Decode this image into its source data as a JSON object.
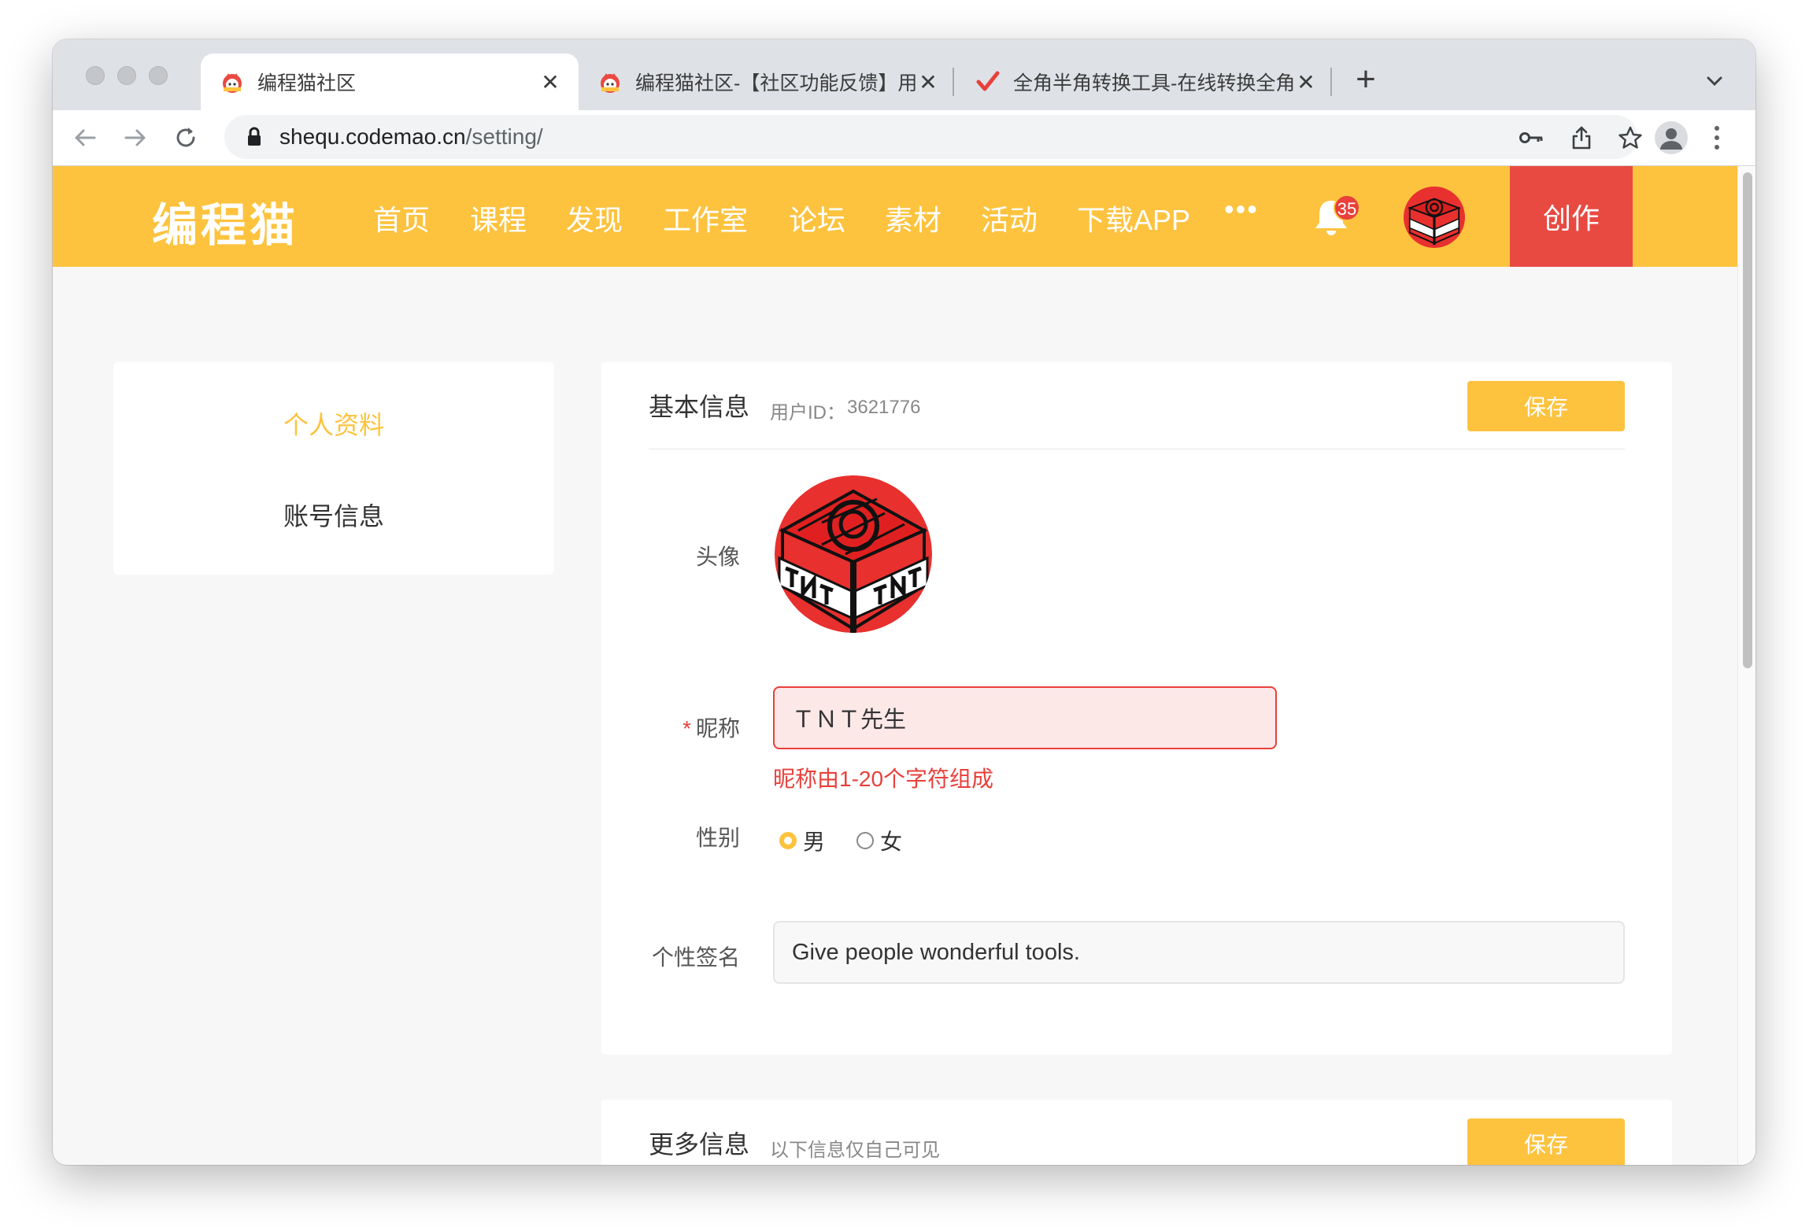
{
  "browser": {
    "tabs": [
      {
        "title": "编程猫社区",
        "active": true
      },
      {
        "title": "编程猫社区-【社区功能反馈】用",
        "active": false
      },
      {
        "title": "全角半角转换工具-在线转换全角",
        "active": false
      }
    ],
    "close_glyph": "✕",
    "new_tab_glyph": "+",
    "url_host": "shequ.codemao.cn",
    "url_path": "/setting/"
  },
  "site": {
    "logo": "编程猫",
    "nav": [
      "首页",
      "课程",
      "发现",
      "工作室",
      "论坛",
      "素材",
      "活动",
      "下载APP"
    ],
    "more": "•••",
    "notification_count": "35",
    "create_label": "创作"
  },
  "sidebar": {
    "items": [
      {
        "label": "个人资料",
        "active": true
      },
      {
        "label": "账号信息",
        "active": false
      }
    ]
  },
  "basic_info": {
    "title": "基本信息",
    "user_id_label": "用户ID：",
    "user_id": "3621776",
    "save_label": "保存",
    "avatar_label": "头像",
    "nickname_required_mark": "*",
    "nickname_label": "昵称",
    "nickname_value": "ＴＮＴ先生",
    "nickname_error": "昵称由1-20个字符组成",
    "gender_label": "性别",
    "gender_options": [
      "男",
      "女"
    ],
    "gender_selected": "男",
    "signature_label": "个性签名",
    "signature_value": "Give people wonderful tools."
  },
  "more_info": {
    "title": "更多信息",
    "subtitle": "以下信息仅自己可见",
    "save_label": "保存"
  },
  "colors": {
    "brand_yellow": "#fdc33f",
    "create_red": "#e84a42",
    "error_red": "#e8403b"
  }
}
